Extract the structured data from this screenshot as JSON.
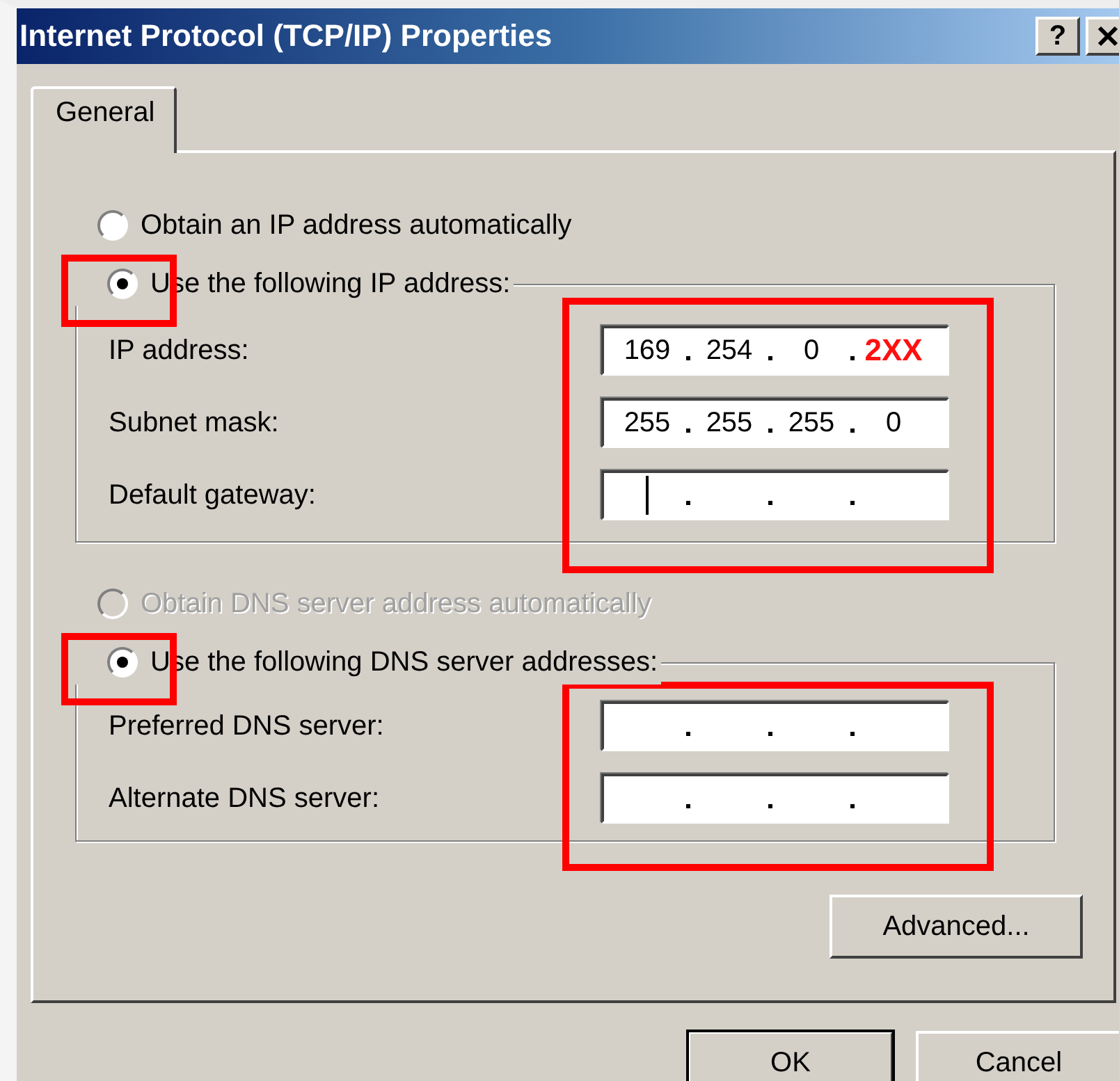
{
  "window": {
    "title": "Internet Protocol (TCP/IP) Properties",
    "help_label": "?"
  },
  "tabs": [
    {
      "label": "General",
      "selected": true
    }
  ],
  "sections": [
    {
      "options": [
        {
          "label": "Obtain an IP address automatically",
          "selected": false,
          "disabled": false,
          "highlighted": false
        },
        {
          "label": "Use the following IP address:",
          "selected": true,
          "disabled": false,
          "highlighted": true
        }
      ],
      "fields_highlighted": true,
      "fields": [
        {
          "label": "IP address:",
          "focused": false,
          "octets": [
            {
              "text": "169",
              "annotated": false
            },
            {
              "text": "254",
              "annotated": false
            },
            {
              "text": "0",
              "annotated": false
            },
            {
              "text": "2XX",
              "annotated": true
            }
          ]
        },
        {
          "label": "Subnet mask:",
          "focused": false,
          "octets": [
            {
              "text": "255",
              "annotated": false
            },
            {
              "text": "255",
              "annotated": false
            },
            {
              "text": "255",
              "annotated": false
            },
            {
              "text": "0",
              "annotated": false
            }
          ]
        },
        {
          "label": "Default gateway:",
          "focused": true
        }
      ]
    },
    {
      "options": [
        {
          "label": "Obtain DNS server address automatically",
          "selected": false,
          "disabled": true,
          "highlighted": false
        },
        {
          "label": "Use the following DNS server addresses:",
          "selected": true,
          "disabled": false,
          "highlighted": true
        }
      ],
      "fields_highlighted": true,
      "fields": [
        {
          "label": "Preferred DNS server:",
          "focused": false
        },
        {
          "label": "Alternate DNS server:",
          "focused": false
        }
      ]
    }
  ],
  "advanced_button": "Advanced...",
  "buttons": [
    {
      "label": "OK",
      "default": true
    },
    {
      "label": "Cancel",
      "default": false
    }
  ]
}
